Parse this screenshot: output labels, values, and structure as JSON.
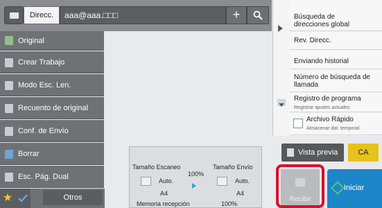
{
  "topbar": {
    "direcc_label": "Direcc.",
    "address_value": "aaa@aaa.□□□",
    "plus_symbol": "+",
    "address_book_icon": "address-book-icon",
    "search_icon": "search-icon"
  },
  "left_menu": [
    {
      "label": "Original",
      "icon": "original-icon"
    },
    {
      "label": "Crear Trabajo",
      "icon": "job-build-icon"
    },
    {
      "label": "Modo Esc. Len.",
      "icon": "slow-scan-icon"
    },
    {
      "label": "Recuento de original",
      "icon": "original-count-icon"
    },
    {
      "label": "Conf. de Envío",
      "icon": "send-settings-icon"
    },
    {
      "label": "Borrar",
      "icon": "erase-icon"
    },
    {
      "label": "Esc. Pág. Dual",
      "icon": "dual-page-icon"
    }
  ],
  "bottom_left": {
    "otros_label": "Otros",
    "star_icon": "star-icon",
    "check_icon": "check-icon"
  },
  "right_panel": {
    "items": [
      {
        "title": "Búsqueda de direcciones global"
      },
      {
        "title": "Rev. Direcc."
      },
      {
        "title": "Enviando historial"
      },
      {
        "title": "Número de búsqueda de llamada"
      },
      {
        "title": "Registro de programa",
        "subtitle": "Registrar ajustes actuales"
      },
      {
        "title": "Archivo Rápido",
        "subtitle": "Almacenar dat. temporal."
      }
    ]
  },
  "status": {
    "scan_size_label": "Tamaño Escaneo",
    "send_size_label": "Tamaño Envío",
    "ratio": "100%",
    "scan_auto": "Auto.",
    "send_auto": "Auto.",
    "scan_paper": "A4",
    "send_paper": "A4",
    "memory_label": "Memoria recepción",
    "memory_value": "100%"
  },
  "buttons": {
    "preview_label": "Vista previa",
    "ca_label": "CA",
    "recibir_label": "Recibir",
    "iniciar_label": "Iniciar"
  },
  "colors": {
    "highlight": "#d8102a",
    "start_button": "#1c86c8",
    "ca_button": "#e7c21a"
  }
}
